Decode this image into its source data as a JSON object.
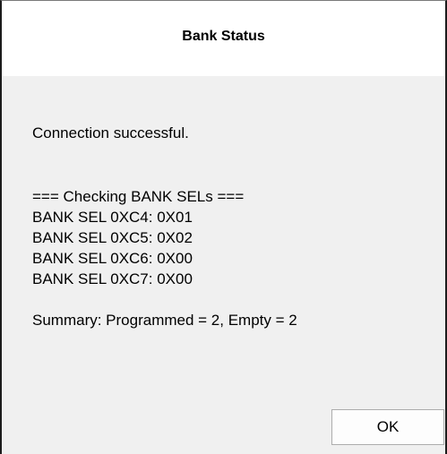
{
  "dialog": {
    "title": "Bank Status",
    "message": {
      "connection": "Connection successful.",
      "header": "=== Checking BANK SELs ===",
      "bank_lines": [
        "BANK SEL 0XC4: 0X01",
        "BANK SEL 0XC5: 0X02",
        "BANK SEL 0XC6: 0X00",
        "BANK SEL 0XC7: 0X00"
      ],
      "summary": "Summary: Programmed = 2, Empty = 2"
    },
    "ok_label": "OK"
  }
}
